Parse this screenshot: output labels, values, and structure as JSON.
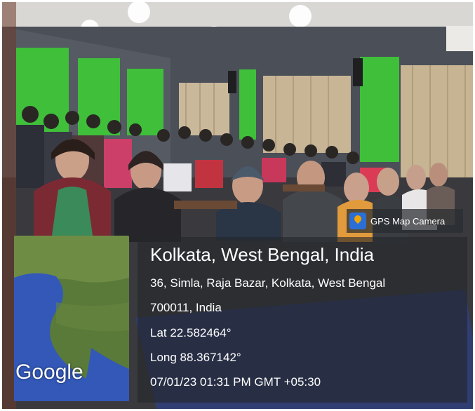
{
  "gps_badge": {
    "label": "GPS Map Camera",
    "icon": "map-pin-icon"
  },
  "location": {
    "title": "Kolkata, West Bengal, India",
    "address_line1": "36, Simla, Raja Bazar, Kolkata, West Bengal",
    "address_line2": "700011, India",
    "latitude": "Lat 22.582464°",
    "longitude": "Long 88.367142°",
    "timestamp": "07/01/23 01:31 PM GMT +05:30"
  },
  "map": {
    "watermark": "Google"
  },
  "colors": {
    "wall_green": "#3fbf3a",
    "wall_gray": "#4a4f58",
    "overlay": "#23262a",
    "sea_blue": "#3358b8"
  }
}
